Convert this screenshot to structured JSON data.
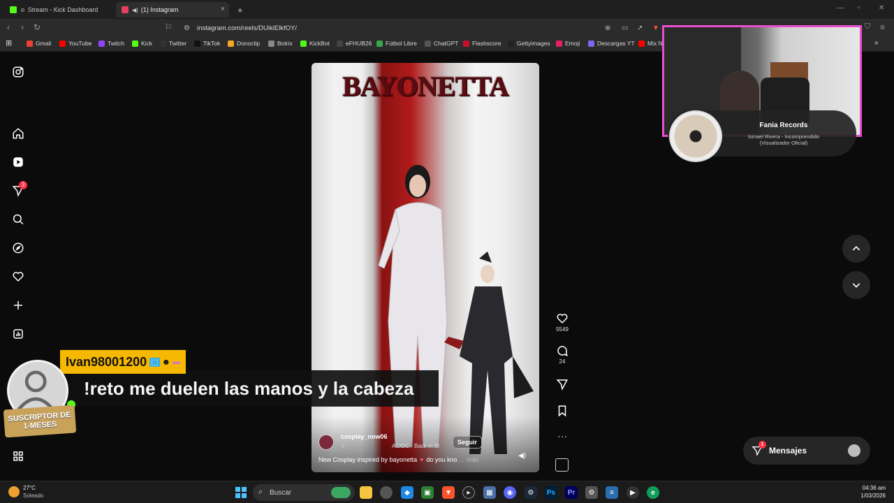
{
  "tabs": [
    {
      "label": "Stream - Kick Dashboard",
      "favicon_color": "#53fc18"
    },
    {
      "label": "(1) Instagram",
      "favicon_color": "#e4405f"
    }
  ],
  "address": {
    "url": "instagram.com/reels/DUiklElkfOY/"
  },
  "bookmarks": [
    {
      "label": "Gmail",
      "icon_color": "#ea4335"
    },
    {
      "label": "YouTube",
      "icon_color": "#ff0000"
    },
    {
      "label": "Twitch",
      "icon_color": "#9146ff"
    },
    {
      "label": "Kick",
      "icon_color": "#53fc18"
    },
    {
      "label": "Twitter",
      "icon_color": "#333333"
    },
    {
      "label": "TikTok",
      "icon_color": "#111111"
    },
    {
      "label": "Donoclip",
      "icon_color": "#f5a623"
    },
    {
      "label": "Botrix",
      "icon_color": "#888888"
    },
    {
      "label": "KickBot",
      "icon_color": "#53fc18"
    },
    {
      "label": "eFHUB26",
      "icon_color": "#444444"
    },
    {
      "label": "Fútbol Libre",
      "icon_color": "#3aa84a"
    },
    {
      "label": "ChatGPT",
      "icon_color": "#555555"
    },
    {
      "label": "Flashscore",
      "icon_color": "#c8102e"
    },
    {
      "label": "Gettyimages",
      "icon_color": "#222222"
    },
    {
      "label": "Emoji",
      "icon_color": "#e91e63"
    },
    {
      "label": "Descargas YT",
      "icon_color": "#7b68ee"
    },
    {
      "label": "Mix N",
      "icon_color": "#ff0000"
    }
  ],
  "sidebar": {
    "notification_count": "3"
  },
  "reel": {
    "title_art": "BAYONETTA",
    "likes": "5549",
    "comments": "24",
    "username": "cosplay_now06",
    "follow_label": "Seguir",
    "audio": "AC/DC · Back In Bl",
    "caption": "New Cosplay inspired by bayonetta",
    "caption_more": "do you kno",
    "more_label": "… más"
  },
  "chat": {
    "username": "Ivan98001200",
    "message": "!reto me duelen las manos y la cabeza",
    "badge_line1": "SUSCRIPTOR DE",
    "badge_line2": "1-MESES"
  },
  "music": {
    "artist": "Fania Records",
    "track_line1": "Ismael Rivera - Incomprendido",
    "track_line2": "(Visualizador Oficial)"
  },
  "messages": {
    "label": "Mensajes",
    "count": "1"
  },
  "taskbar": {
    "weather_temp": "27°C",
    "weather_desc": "Soleado",
    "search_placeholder": "Buscar",
    "time": "04:36 am",
    "date": "1/03/2026"
  }
}
